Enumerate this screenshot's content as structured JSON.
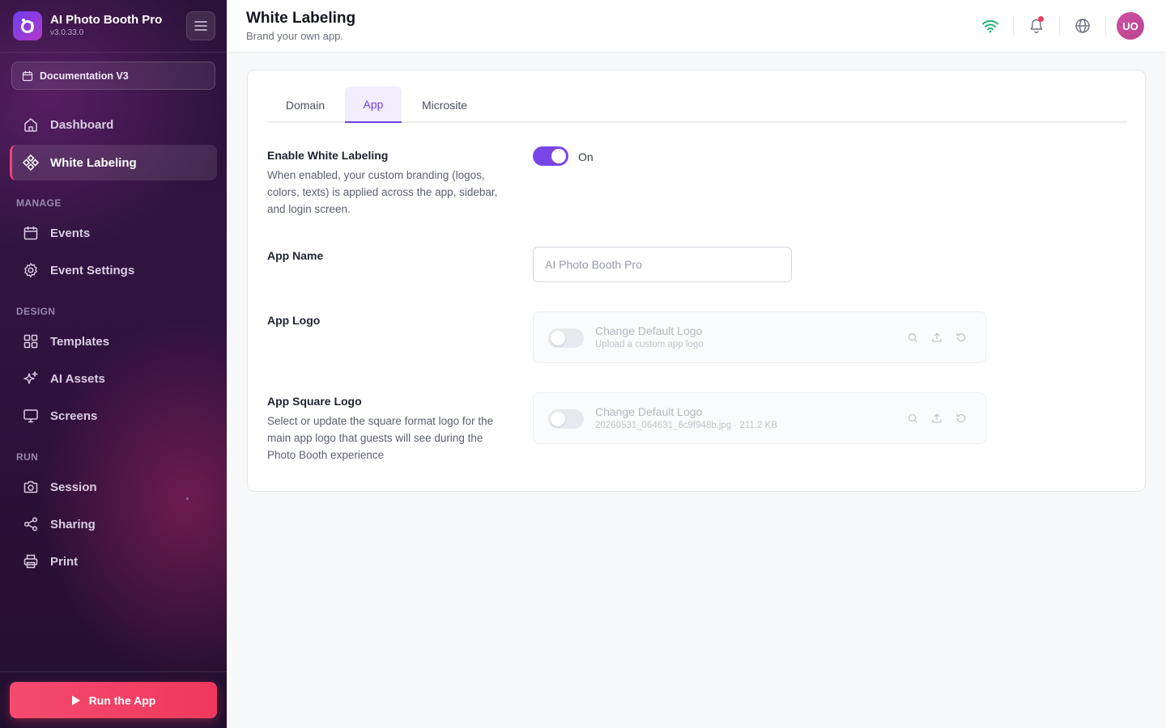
{
  "app": {
    "name": "AI Photo Booth Pro",
    "version": "v3.0.33.0"
  },
  "project": {
    "label": "Documentation V3"
  },
  "sidebar": {
    "items": [
      {
        "label": "Dashboard",
        "icon": "home-icon"
      },
      {
        "label": "White Labeling",
        "icon": "diamond-nodes-icon",
        "active": true
      }
    ],
    "sections": [
      {
        "title": "MANAGE",
        "items": [
          {
            "label": "Events",
            "icon": "calendar-icon"
          },
          {
            "label": "Event Settings",
            "icon": "gear-icon"
          }
        ]
      },
      {
        "title": "DESIGN",
        "items": [
          {
            "label": "Templates",
            "icon": "grid-icon"
          },
          {
            "label": "AI Assets",
            "icon": "sparkles-icon"
          },
          {
            "label": "Screens",
            "icon": "monitor-icon"
          }
        ]
      },
      {
        "title": "RUN",
        "items": [
          {
            "label": "Session",
            "icon": "camera-icon"
          },
          {
            "label": "Sharing",
            "icon": "share-icon"
          },
          {
            "label": "Print",
            "icon": "printer-icon"
          }
        ]
      }
    ],
    "run_button": "Run the App"
  },
  "header": {
    "title": "White Labeling",
    "subtitle": "Brand your own app.",
    "avatar_initials": "UO"
  },
  "tabs": [
    {
      "label": "Domain",
      "active": false
    },
    {
      "label": "App",
      "active": true
    },
    {
      "label": "Microsite",
      "active": false
    }
  ],
  "form": {
    "enable": {
      "label": "Enable White Labeling",
      "description": "When enabled, your custom branding (logos, colors, texts) is applied across the app, sidebar, and login screen.",
      "toggle_on": true,
      "toggle_text": "On"
    },
    "app_name": {
      "label": "App Name",
      "value": "",
      "placeholder": "AI Photo Booth Pro"
    },
    "app_logo": {
      "label": "App Logo",
      "toggle_on": false,
      "title": "Change Default Logo",
      "subtitle": "Upload a custom app logo"
    },
    "app_square_logo": {
      "label": "App Square Logo",
      "description": "Select or update the square format logo for the main app logo that guests will see during the Photo Booth experience",
      "toggle_on": false,
      "title": "Change Default Logo",
      "subtitle": "20260531_064631_6c9f948b.jpg · 211.2 KB"
    }
  },
  "colors": {
    "accent": "#7a45e6",
    "run_button": "#f0385e",
    "wifi": "#22b573"
  }
}
